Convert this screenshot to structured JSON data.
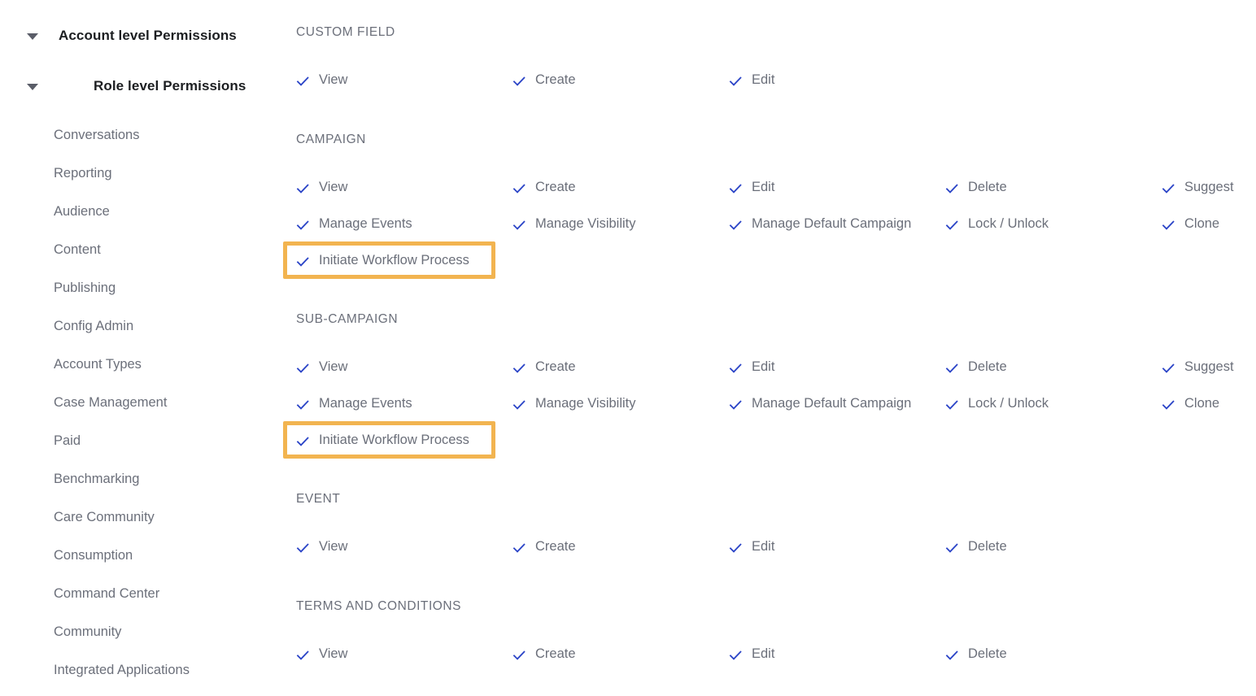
{
  "sidebar": {
    "groups": [
      {
        "label": "Account level Permissions",
        "icon": "caret-down-icon",
        "expanded": true
      },
      {
        "label": "Role level Permissions",
        "icon": "caret-down-icon",
        "expanded": true
      }
    ],
    "items": [
      {
        "label": "Conversations"
      },
      {
        "label": "Reporting"
      },
      {
        "label": "Audience"
      },
      {
        "label": "Content"
      },
      {
        "label": "Publishing"
      },
      {
        "label": "Config Admin"
      },
      {
        "label": "Account Types"
      },
      {
        "label": "Case Management"
      },
      {
        "label": "Paid"
      },
      {
        "label": "Benchmarking"
      },
      {
        "label": "Care Community"
      },
      {
        "label": "Consumption"
      },
      {
        "label": "Command Center"
      },
      {
        "label": "Community"
      },
      {
        "label": "Integrated Applications"
      }
    ]
  },
  "colors": {
    "check": "#2b44c7",
    "highlight_border": "#f2b450",
    "heading_text": "#6b6f7a",
    "group_text": "#1c1e21"
  },
  "sections": [
    {
      "id": "custom-field",
      "title": "CUSTOM FIELD",
      "permissions": [
        {
          "label": "View",
          "checked": true
        },
        {
          "label": "Create",
          "checked": true
        },
        {
          "label": "Edit",
          "checked": true
        }
      ]
    },
    {
      "id": "campaign",
      "title": "CAMPAIGN",
      "permissions": [
        {
          "label": "View",
          "checked": true
        },
        {
          "label": "Create",
          "checked": true
        },
        {
          "label": "Edit",
          "checked": true
        },
        {
          "label": "Delete",
          "checked": true
        },
        {
          "label": "Suggest",
          "checked": true
        },
        {
          "label": "Manage Events",
          "checked": true
        },
        {
          "label": "Manage Visibility",
          "checked": true
        },
        {
          "label": "Manage Default Campaign",
          "checked": true
        },
        {
          "label": "Lock / Unlock",
          "checked": true
        },
        {
          "label": "Clone",
          "checked": true
        },
        {
          "label": "Initiate Workflow Process",
          "checked": true,
          "highlighted": true
        }
      ]
    },
    {
      "id": "sub-campaign",
      "title": "SUB-CAMPAIGN",
      "permissions": [
        {
          "label": "View",
          "checked": true
        },
        {
          "label": "Create",
          "checked": true
        },
        {
          "label": "Edit",
          "checked": true
        },
        {
          "label": "Delete",
          "checked": true
        },
        {
          "label": "Suggest",
          "checked": true
        },
        {
          "label": "Manage Events",
          "checked": true
        },
        {
          "label": "Manage Visibility",
          "checked": true
        },
        {
          "label": "Manage Default Campaign",
          "checked": true
        },
        {
          "label": "Lock / Unlock",
          "checked": true
        },
        {
          "label": "Clone",
          "checked": true
        },
        {
          "label": "Initiate Workflow Process",
          "checked": true,
          "highlighted": true
        }
      ]
    },
    {
      "id": "event",
      "title": "EVENT",
      "permissions": [
        {
          "label": "View",
          "checked": true
        },
        {
          "label": "Create",
          "checked": true
        },
        {
          "label": "Edit",
          "checked": true
        },
        {
          "label": "Delete",
          "checked": true
        }
      ]
    },
    {
      "id": "terms-and-conditions",
      "title": "TERMS AND CONDITIONS",
      "permissions": [
        {
          "label": "View",
          "checked": true
        },
        {
          "label": "Create",
          "checked": true
        },
        {
          "label": "Edit",
          "checked": true
        },
        {
          "label": "Delete",
          "checked": true
        }
      ]
    }
  ]
}
